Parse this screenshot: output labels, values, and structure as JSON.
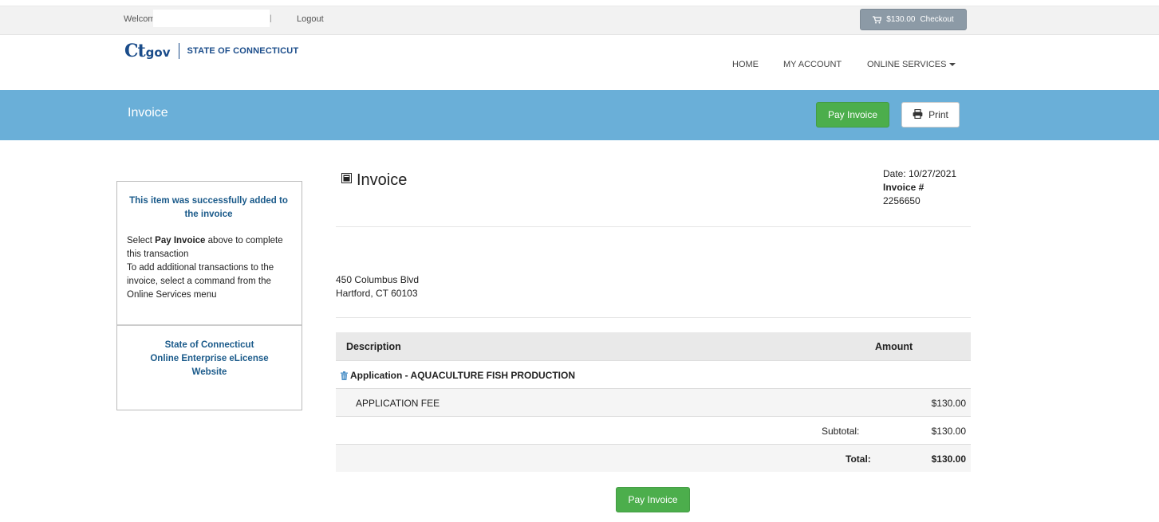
{
  "topbar": {
    "welcome": "Welcome,",
    "separator": "|",
    "logout": "Logout",
    "cart_total": "$130.00",
    "checkout": "Checkout"
  },
  "header": {
    "logo_ct": "Ct",
    "logo_gov": "gov",
    "logo_state": "STATE OF CONNECTICUT",
    "nav": {
      "home": "HOME",
      "account": "MY ACCOUNT",
      "services": "ONLINE SERVICES"
    }
  },
  "banner": {
    "title": "Invoice",
    "pay_button": "Pay Invoice",
    "print_button": "Print"
  },
  "sidebar": {
    "success": "This item was successfully added to the invoice",
    "instruction_pre": "Select ",
    "instruction_bold": "Pay Invoice",
    "instruction_post": " above to complete this transaction",
    "instruction_more": "To add additional transactions to the invoice, select a command from the Online Services menu",
    "site_line1": "State of Connecticut",
    "site_line2": "Online Enterprise eLicense",
    "site_line3": "Website"
  },
  "invoice": {
    "title": "Invoice",
    "date": "Date: 10/27/2021",
    "number_label": "Invoice #",
    "number": "2256650",
    "address_line1": "450 Columbus Blvd",
    "address_line2": "Hartford, CT 60103",
    "table": {
      "col_description": "Description",
      "col_amount": "Amount",
      "item_title": "Application - AQUACULTURE FISH PRODUCTION",
      "fee_label": "APPLICATION FEE",
      "fee_amount": "$130.00",
      "subtotal_label": "Subtotal:",
      "subtotal": "$130.00",
      "total_label": "Total:",
      "total": "$130.00"
    },
    "pay_button": "Pay Invoice"
  },
  "colors": {
    "banner": "#6aafd8",
    "pay_green": "#4cae4c",
    "link_blue": "#1a5a8a"
  }
}
